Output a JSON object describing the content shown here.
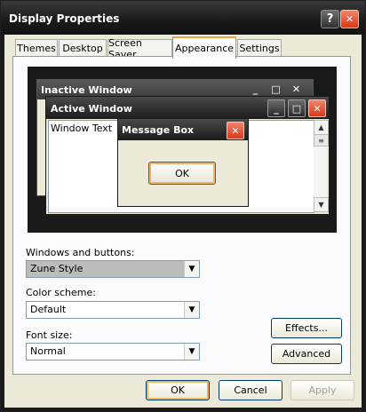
{
  "window": {
    "title": "Display Properties",
    "help_glyph": "?",
    "close_glyph": "✕"
  },
  "tabs": [
    {
      "label": "Themes",
      "active": false
    },
    {
      "label": "Desktop",
      "active": false
    },
    {
      "label": "Screen Saver",
      "active": false
    },
    {
      "label": "Appearance",
      "active": true
    },
    {
      "label": "Settings",
      "active": false
    }
  ],
  "preview": {
    "inactive_title": "Inactive Window",
    "active_title": "Active Window",
    "window_text": "Window Text",
    "message_box_title": "Message Box",
    "message_ok": "OK",
    "button_glyphs": {
      "minimize": "_",
      "maximize": "□",
      "close": "✕"
    }
  },
  "fields": {
    "windows_buttons": {
      "label": "Windows and buttons:",
      "value": "Zune Style"
    },
    "color_scheme": {
      "label": "Color scheme:",
      "value": "Default"
    },
    "font_size": {
      "label": "Font size:",
      "value": "Normal"
    }
  },
  "buttons": {
    "effects": "Effects...",
    "advanced": "Advanced",
    "ok": "OK",
    "cancel": "Cancel",
    "apply": "Apply"
  },
  "colors": {
    "accent_orange": "#f0b25a",
    "close_red": "#d8391a",
    "dialog_face": "#ece9d8"
  }
}
